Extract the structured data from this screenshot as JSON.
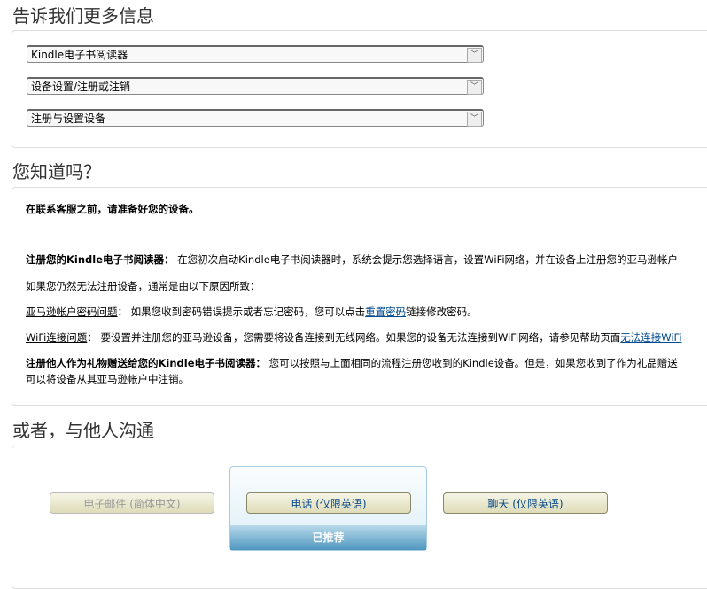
{
  "section1": {
    "title": "告诉我们更多信息",
    "selects": [
      "Kindle电子书阅读器",
      "设备设置/注册或注销",
      "注册与设置设备"
    ]
  },
  "section2": {
    "title": "您知道吗？",
    "intro": "在联系客服之前，请准备好您的设备。",
    "p1_bold": "注册您的Kindle电子书阅读器：",
    "p1_text": " 在您初次启动Kindle电子书阅读器时，系统会提示您选择语言，设置WiFi网络，并在设备上注册您的亚马逊帐户",
    "p2": "如果您仍然无法注册设备，通常是由以下原因所致：",
    "p3_label": "亚马逊帐户密码问题",
    "p3_text": "： 如果您收到密码错误提示或者忘记密码，您可以点击",
    "p3_link": "重置密码",
    "p3_end": "链接修改密码。",
    "p4_label": "WiFi连接问题",
    "p4_text": "： 要设置并注册您的亚马逊设备，您需要将设备连接到无线网络。如果您的设备无法连接到WiFi网络，请参见帮助页面",
    "p4_link": "无法连接WiFi",
    "p5_bold": "注册他人作为礼物赠送给您的Kindle电子书阅读器：",
    "p5_text": " 您可以按照与上面相同的流程注册您收到的Kindle设备。但是，如果您收到了作为礼品赠送",
    "p5_line2": "可以将设备从其亚马逊帐户中注销。"
  },
  "section3": {
    "title": "或者，与他人沟通",
    "email": "电子邮件 (简体中文)",
    "phone": "电话 (仅限英语)",
    "chat": "聊天 (仅限英语)",
    "recommended": "已推荐"
  }
}
